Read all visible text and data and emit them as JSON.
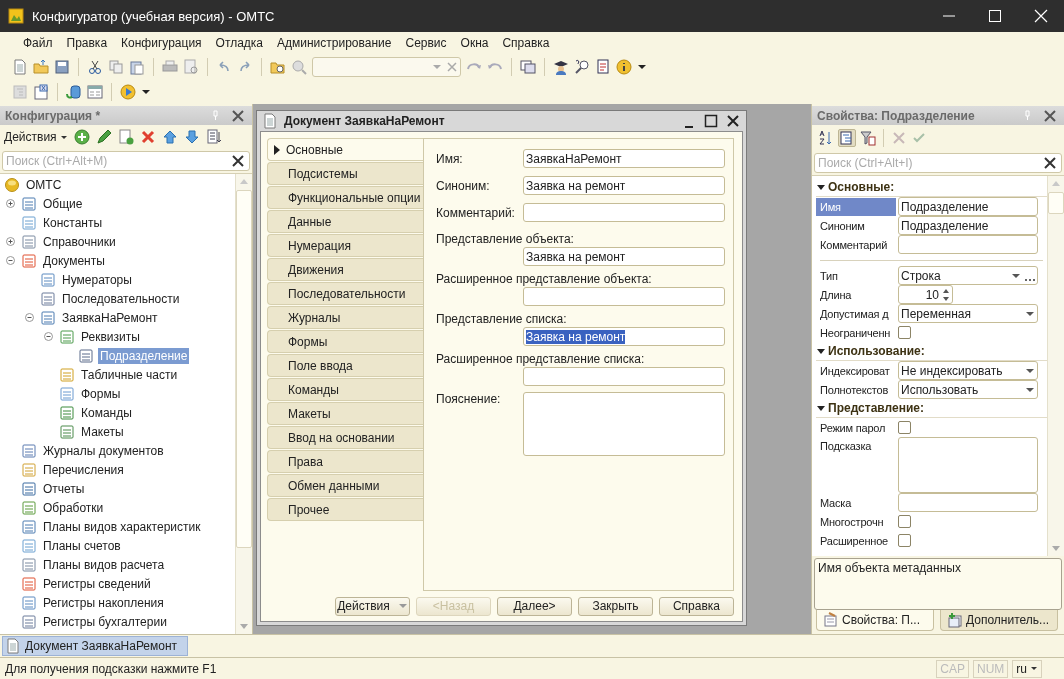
{
  "window": {
    "title": "Конфигуратор (учебная версия) - ОМТС"
  },
  "menu": [
    "Файл",
    "Правка",
    "Конфигурация",
    "Отладка",
    "Администрирование",
    "Сервис",
    "Окна",
    "Справка"
  ],
  "config_panel": {
    "title": "Конфигурация *",
    "actions_label": "Действия",
    "search_placeholder": "Поиск (Ctrl+Alt+M)",
    "tree": [
      {
        "label": "ОМТС",
        "selected": false,
        "children": [
          {
            "label": "Общие",
            "selected": false,
            "expanded": false
          },
          {
            "label": "Константы",
            "selected": false
          },
          {
            "label": "Справочники",
            "selected": false,
            "expanded": false
          },
          {
            "label": "Документы",
            "selected": false,
            "expanded": true,
            "children": [
              {
                "label": "Нумераторы",
                "selected": false
              },
              {
                "label": "Последовательности",
                "selected": false
              },
              {
                "label": "ЗаявкаНаРемонт",
                "selected": false,
                "expanded": true,
                "children": [
                  {
                    "label": "Реквизиты",
                    "selected": false,
                    "expanded": true,
                    "children": [
                      {
                        "label": "Подразделение",
                        "selected": true
                      }
                    ]
                  },
                  {
                    "label": "Табличные части",
                    "selected": false
                  },
                  {
                    "label": "Формы",
                    "selected": false
                  },
                  {
                    "label": "Команды",
                    "selected": false
                  },
                  {
                    "label": "Макеты",
                    "selected": false
                  }
                ]
              }
            ]
          },
          {
            "label": "Журналы документов",
            "selected": false
          },
          {
            "label": "Перечисления",
            "selected": false
          },
          {
            "label": "Отчеты",
            "selected": false
          },
          {
            "label": "Обработки",
            "selected": false
          },
          {
            "label": "Планы видов характеристик",
            "selected": false
          },
          {
            "label": "Планы счетов",
            "selected": false
          },
          {
            "label": "Планы видов расчета",
            "selected": false
          },
          {
            "label": "Регистры сведений",
            "selected": false
          },
          {
            "label": "Регистры накопления",
            "selected": false
          },
          {
            "label": "Регистры бухгалтерии",
            "selected": false
          }
        ]
      }
    ]
  },
  "dialog": {
    "title": "Документ ЗаявкаНаРемонт",
    "tabs": [
      {
        "label": "Основные",
        "selected": true
      },
      {
        "label": "Подсистемы",
        "selected": false
      },
      {
        "label": "Функциональные опции",
        "selected": false
      },
      {
        "label": "Данные",
        "selected": false
      },
      {
        "label": "Нумерация",
        "selected": false
      },
      {
        "label": "Движения",
        "selected": false
      },
      {
        "label": "Последовательности",
        "selected": false
      },
      {
        "label": "Журналы",
        "selected": false
      },
      {
        "label": "Формы",
        "selected": false
      },
      {
        "label": "Поле ввода",
        "selected": false
      },
      {
        "label": "Команды",
        "selected": false
      },
      {
        "label": "Макеты",
        "selected": false
      },
      {
        "label": "Ввод на основании",
        "selected": false
      },
      {
        "label": "Права",
        "selected": false
      },
      {
        "label": "Обмен данными",
        "selected": false
      },
      {
        "label": "Прочее",
        "selected": false
      }
    ],
    "fields": [
      {
        "label": "Имя:",
        "value": "ЗаявкаНаРемонт",
        "kind": "inline",
        "text_selected": false
      },
      {
        "label": "Синоним:",
        "value": "Заявка на ремонт",
        "kind": "inline",
        "text_selected": false
      },
      {
        "label": "Комментарий:",
        "kind": "inline"
      },
      {
        "label": "Представление объекта:",
        "value": "Заявка на ремонт",
        "kind": "stacked",
        "text_selected": false
      },
      {
        "label": "Расширенное представление объекта:",
        "kind": "stacked"
      },
      {
        "label": "Представление списка:",
        "value": "Заявка на ремонт",
        "kind": "stacked",
        "text_selected": true
      },
      {
        "label": "Расширенное представление списка:",
        "kind": "stacked"
      },
      {
        "label": "Пояснение:",
        "kind": "textarea"
      }
    ],
    "buttons": [
      {
        "label": "Действия",
        "kind": "menu",
        "disabled": false
      },
      {
        "label": "<Назад",
        "kind": "plain",
        "disabled": true
      },
      {
        "label": "Далее>",
        "kind": "plain",
        "disabled": false
      },
      {
        "label": "Закрыть",
        "kind": "plain",
        "disabled": false
      },
      {
        "label": "Справка",
        "kind": "plain",
        "disabled": false
      }
    ]
  },
  "properties_panel": {
    "title": "Свойства: Подразделение",
    "search_placeholder": "Поиск (Ctrl+Alt+I)",
    "sections": [
      {
        "title": "Основные:",
        "expanded": true,
        "rows": [
          {
            "kind": "text",
            "label": "Имя",
            "value": "Подразделение",
            "selected": true
          },
          {
            "kind": "text",
            "label": "Синоним",
            "value": "Подразделение",
            "selected": false
          },
          {
            "kind": "text",
            "label": "Комментарий",
            "selected": false
          },
          {
            "kind": "separator"
          },
          {
            "kind": "type-select",
            "label": "Тип",
            "value": "Строка",
            "selected": false
          },
          {
            "kind": "spin",
            "label": "Длина",
            "value": "10",
            "selected": false
          },
          {
            "kind": "select",
            "label": "Допустимая д",
            "value": "Переменная",
            "selected": false
          },
          {
            "kind": "checkbox",
            "label": "Неограниченн",
            "checked": false,
            "selected": false
          }
        ]
      },
      {
        "title": "Использование:",
        "expanded": true,
        "rows": [
          {
            "kind": "select",
            "label": "Индексироват",
            "value": "Не индексировать",
            "selected": false
          },
          {
            "kind": "select",
            "label": "Полнотекстов",
            "value": "Использовать",
            "selected": false
          }
        ]
      },
      {
        "title": "Представление:",
        "expanded": true,
        "rows": [
          {
            "kind": "checkbox",
            "label": "Режим парол",
            "checked": false,
            "selected": false
          },
          {
            "kind": "textarea",
            "label": "Подсказка",
            "selected": false
          },
          {
            "kind": "text",
            "label": "Маска",
            "selected": false
          },
          {
            "kind": "checkbox",
            "label": "Многострочн",
            "checked": false,
            "selected": false
          },
          {
            "kind": "checkbox",
            "label": "Расширенное",
            "checked": false,
            "selected": false
          }
        ]
      }
    ],
    "description": "Имя объекта метаданных",
    "tabs": [
      {
        "label": "Свойства: П...",
        "selected": true
      },
      {
        "label": "Дополнитель...",
        "selected": false
      }
    ]
  },
  "taskbar": [
    {
      "label": "Документ ЗаявкаНаРемонт",
      "selected": true
    }
  ],
  "status_bar": {
    "hint": "Для получения подсказки нажмите F1",
    "indicators": [
      {
        "label": "CAP",
        "on": false
      },
      {
        "label": "NUM",
        "on": false
      }
    ],
    "language": "ru"
  }
}
